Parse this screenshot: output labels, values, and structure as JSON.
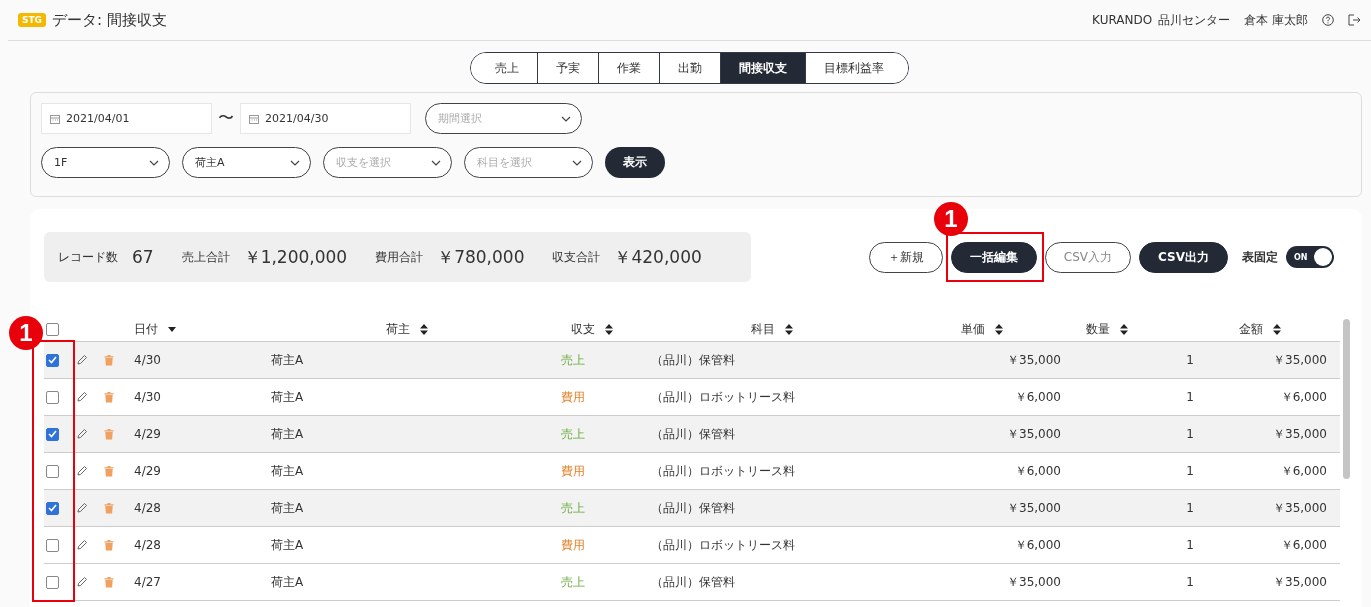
{
  "header": {
    "badge": "STG",
    "title": "データ: 間接収支",
    "company": "KURANDO",
    "center": "品川センター",
    "user": "倉本 庫太郎"
  },
  "tabs": [
    {
      "label": "売上",
      "selected": false
    },
    {
      "label": "予実",
      "selected": false
    },
    {
      "label": "作業",
      "selected": false
    },
    {
      "label": "出勤",
      "selected": false
    },
    {
      "label": "間接収支",
      "selected": true
    },
    {
      "label": "目標利益率",
      "selected": false
    }
  ],
  "filters": {
    "date_from": "2021/04/01",
    "date_separator": "〜",
    "date_to": "2021/04/30",
    "period": {
      "placeholder": "期間選択"
    },
    "selects": [
      {
        "value": "1F"
      },
      {
        "value": "荷主A"
      },
      {
        "placeholder": "収支を選択"
      },
      {
        "placeholder": "科目を選択"
      }
    ],
    "show_button": "表示"
  },
  "summary": [
    {
      "label": "レコード数",
      "value": "67"
    },
    {
      "label": "売上合計",
      "value": "￥1,200,000"
    },
    {
      "label": "費用合計",
      "value": "￥780,000"
    },
    {
      "label": "収支合計",
      "value": "￥420,000"
    }
  ],
  "actions": [
    {
      "label": "＋新規",
      "kind": "outline"
    },
    {
      "label": "一括編集",
      "kind": "dark"
    },
    {
      "label": "CSV入力",
      "kind": "outline-muted"
    },
    {
      "label": "CSV出力",
      "kind": "dark"
    }
  ],
  "table_fixed": {
    "label": "表固定",
    "on": true,
    "text": "ON"
  },
  "table": {
    "select_all_checked": false,
    "columns": [
      {
        "label": "日付",
        "sorted": true
      },
      {
        "label": "荷主",
        "sorted": false
      },
      {
        "label": "収支",
        "sorted": false
      },
      {
        "label": "科目",
        "sorted": false
      },
      {
        "label": "単価",
        "sorted": false
      },
      {
        "label": "数量",
        "sorted": false
      },
      {
        "label": "金額",
        "sorted": false
      }
    ],
    "rows": [
      {
        "checked": true,
        "date": "4/30",
        "shipper": "荷主A",
        "type": "売上",
        "kind": "income",
        "item": "（品川）保管料",
        "unit_price": "￥35,000",
        "quantity": "1",
        "amount": "￥35,000"
      },
      {
        "checked": false,
        "date": "4/30",
        "shipper": "荷主A",
        "type": "費用",
        "kind": "expense",
        "item": "（品川）ロボットリース料",
        "unit_price": "￥6,000",
        "quantity": "1",
        "amount": "￥6,000"
      },
      {
        "checked": true,
        "date": "4/29",
        "shipper": "荷主A",
        "type": "売上",
        "kind": "income",
        "item": "（品川）保管料",
        "unit_price": "￥35,000",
        "quantity": "1",
        "amount": "￥35,000"
      },
      {
        "checked": false,
        "date": "4/29",
        "shipper": "荷主A",
        "type": "費用",
        "kind": "expense",
        "item": "（品川）ロボットリース料",
        "unit_price": "￥6,000",
        "quantity": "1",
        "amount": "￥6,000"
      },
      {
        "checked": true,
        "date": "4/28",
        "shipper": "荷主A",
        "type": "売上",
        "kind": "income",
        "item": "（品川）保管料",
        "unit_price": "￥35,000",
        "quantity": "1",
        "amount": "￥35,000"
      },
      {
        "checked": false,
        "date": "4/28",
        "shipper": "荷主A",
        "type": "費用",
        "kind": "expense",
        "item": "（品川）ロボットリース料",
        "unit_price": "￥6,000",
        "quantity": "1",
        "amount": "￥6,000"
      },
      {
        "checked": false,
        "date": "4/27",
        "shipper": "荷主A",
        "type": "売上",
        "kind": "income",
        "item": "（品川）保管料",
        "unit_price": "￥35,000",
        "quantity": "1",
        "amount": "￥35,000"
      }
    ]
  },
  "callouts": [
    {
      "label": "1"
    },
    {
      "label": "1"
    }
  ]
}
